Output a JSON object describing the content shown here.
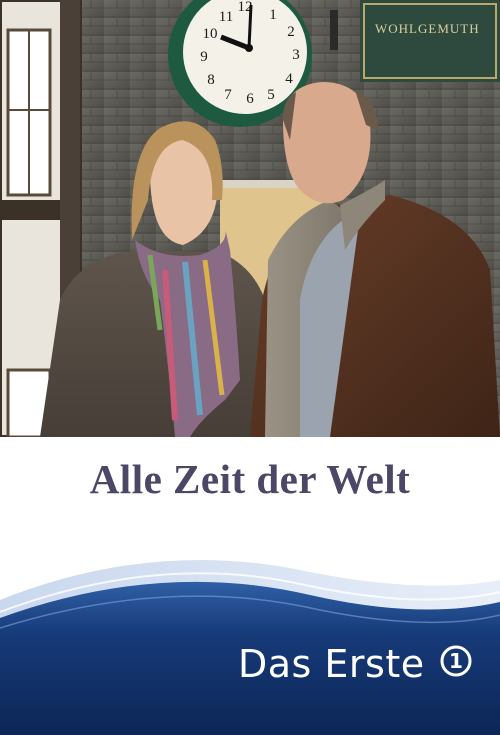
{
  "poster": {
    "title": "Alle Zeit der Welt",
    "broadcaster": "Das Erste",
    "logo_mark": "1",
    "sign_text": "WOHLGEMUTH",
    "clock_numbers": [
      "12",
      "1",
      "2",
      "3",
      "4",
      "5",
      "6",
      "7",
      "8",
      "9",
      "10",
      "11"
    ]
  },
  "colors": {
    "title": "#4b4766",
    "band_dark": "#0d2a5c",
    "band_mid": "#1e4a8a",
    "clock_frame": "#1d5a3f"
  }
}
